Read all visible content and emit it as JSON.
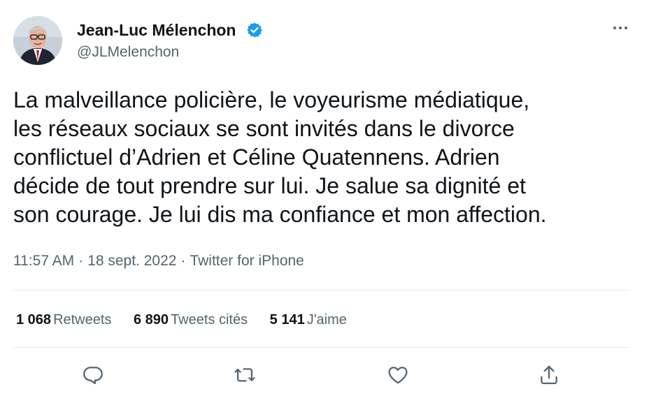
{
  "tweet": {
    "author": {
      "name": "Jean-Luc Mélenchon",
      "handle": "@JLMelenchon",
      "verified": true,
      "verified_color": "#1d9bf0"
    },
    "more_icon": "more-horizontal-icon",
    "text_lines": [
      "La malveillance policière, le voyeurisme médiatique,",
      "les réseaux sociaux se sont invités dans le divorce",
      "conflictuel d’Adrien et Céline Quatennens. Adrien",
      "décide de tout prendre sur lui. Je salue sa dignité et",
      "son courage. Je lui dis ma confiance et mon affection."
    ],
    "time": "11:57 AM",
    "date": "18 sept. 2022",
    "source": "Twitter for iPhone",
    "separator": "·",
    "stats": {
      "retweets": {
        "count": "1 068",
        "label": "Retweets"
      },
      "quotes": {
        "count": "6 890",
        "label": "Tweets cités"
      },
      "likes": {
        "count": "5 141",
        "label": "J'aime"
      }
    },
    "actions": [
      "reply-icon",
      "retweet-icon",
      "like-icon",
      "share-icon"
    ],
    "colors": {
      "text": "#0f1419",
      "secondary": "#536471",
      "divider": "#e6ecf0"
    }
  }
}
